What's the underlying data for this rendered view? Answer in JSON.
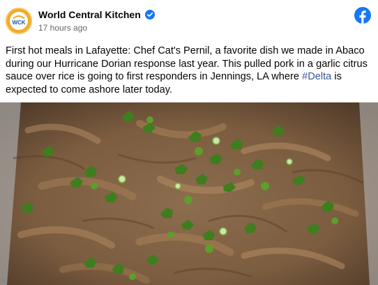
{
  "post": {
    "author": "World Central Kitchen",
    "avatar_text": "WCK",
    "timestamp": "17 hours ago",
    "text_before": "First hot meals in Lafayette: Chef Cat's Pernil, a favorite dish we made in Abaco during our Hurricane Dorian response last year. This pulled pork in a garlic citrus sauce over rice is going to first responders in Jennings, LA where ",
    "hashtag": "#Delta",
    "text_after": " is expected to come ashore later today."
  },
  "icons": {
    "verified": "verified-badge-icon",
    "platform": "facebook-icon"
  },
  "colors": {
    "verified_blue": "#1877f2",
    "facebook_blue": "#1877f2",
    "hashtag": "#385898",
    "avatar_orange": "#f3a92a"
  }
}
